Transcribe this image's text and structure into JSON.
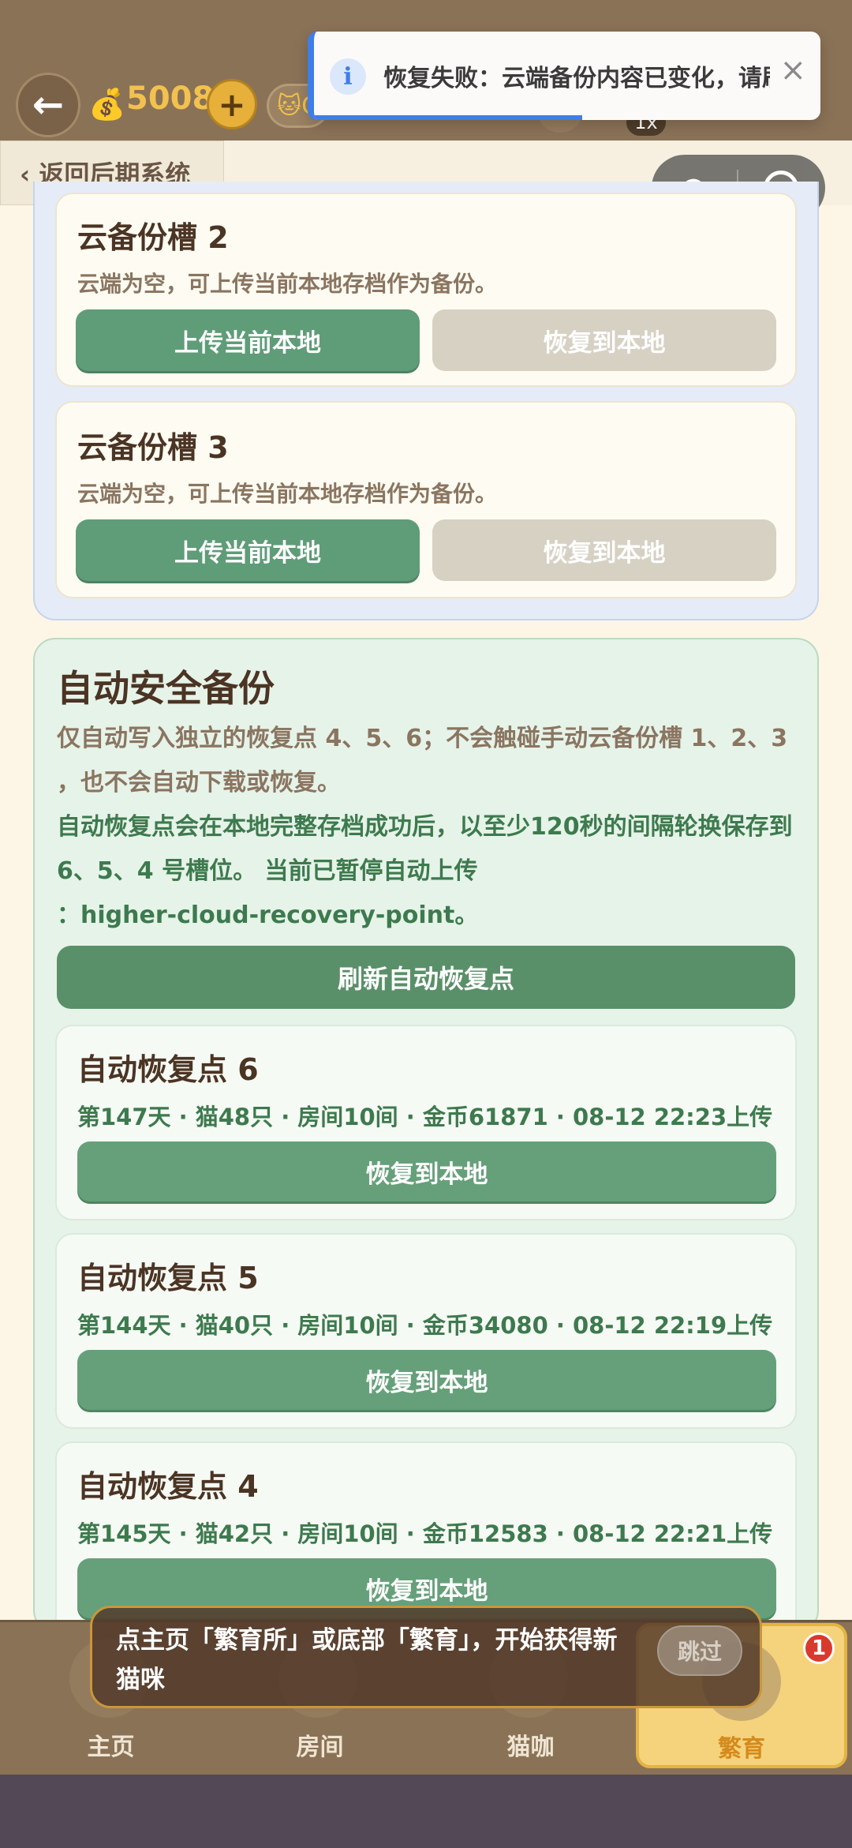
{
  "topbar": {
    "coins": "5008",
    "plus_label": "+",
    "cat_chip_label": "🐱C",
    "speed_badge": "1x"
  },
  "toast": {
    "icon": "i",
    "message": "恢复失败：云端备份内容已变化，请刷新后重试",
    "close": "×",
    "progress_fraction": 0.53
  },
  "subheader": {
    "back_label": "‹ 返回后期系统"
  },
  "cloud_slots": [
    {
      "title": "云备份槽 2",
      "desc": "云端为空，可上传当前本地存档作为备份。",
      "upload_label": "上传当前本地",
      "restore_label": "恢复到本地"
    },
    {
      "title": "云备份槽 3",
      "desc": "云端为空，可上传当前本地存档作为备份。",
      "upload_label": "上传当前本地",
      "restore_label": "恢复到本地"
    }
  ],
  "auto_backup": {
    "title": "自动安全备份",
    "p1_line1": "仅自动写入独立的恢复点 4、5、6；不会触碰手动云备份槽 1、2、3",
    "p1_line2": "，也不会自动下载或恢复。",
    "p2_line1": "自动恢复点会在本地完整存档成功后，以至少120秒的间隔轮换保存到",
    "p2_line2": "6、5、4 号槽位。 当前已暂停自动上传",
    "p2_line3": "：higher-cloud-recovery-point。",
    "refresh_label": "刷新自动恢复点",
    "points": [
      {
        "title": "自动恢复点 6",
        "meta": "第147天 · 猫48只 · 房间10间 · 金币61871 · 08-12 22:23上传",
        "restore_label": "恢复到本地"
      },
      {
        "title": "自动恢复点 5",
        "meta": "第144天 · 猫40只 · 房间10间 · 金币34080 · 08-12 22:19上传",
        "restore_label": "恢复到本地"
      },
      {
        "title": "自动恢复点 4",
        "meta": "第145天 · 猫42只 · 房间10间 · 金币12583 · 08-12 22:21上传",
        "restore_label": "恢复到本地"
      }
    ]
  },
  "tip": {
    "text_line1": "点主页「繁育所」或底部「繁育」，开始获得新",
    "text_line2": "猫咪",
    "skip_label": "跳过"
  },
  "bottom_nav": {
    "items": [
      {
        "label": "主页"
      },
      {
        "label": "房间"
      },
      {
        "label": "猫咖"
      },
      {
        "label": "繁育",
        "badge": "1"
      }
    ]
  },
  "colors": {
    "accent_green": "#5f9c78",
    "topbar_brown": "#8a7257",
    "toast_blue": "#3f7ee8",
    "badge_red": "#d93a2e"
  }
}
